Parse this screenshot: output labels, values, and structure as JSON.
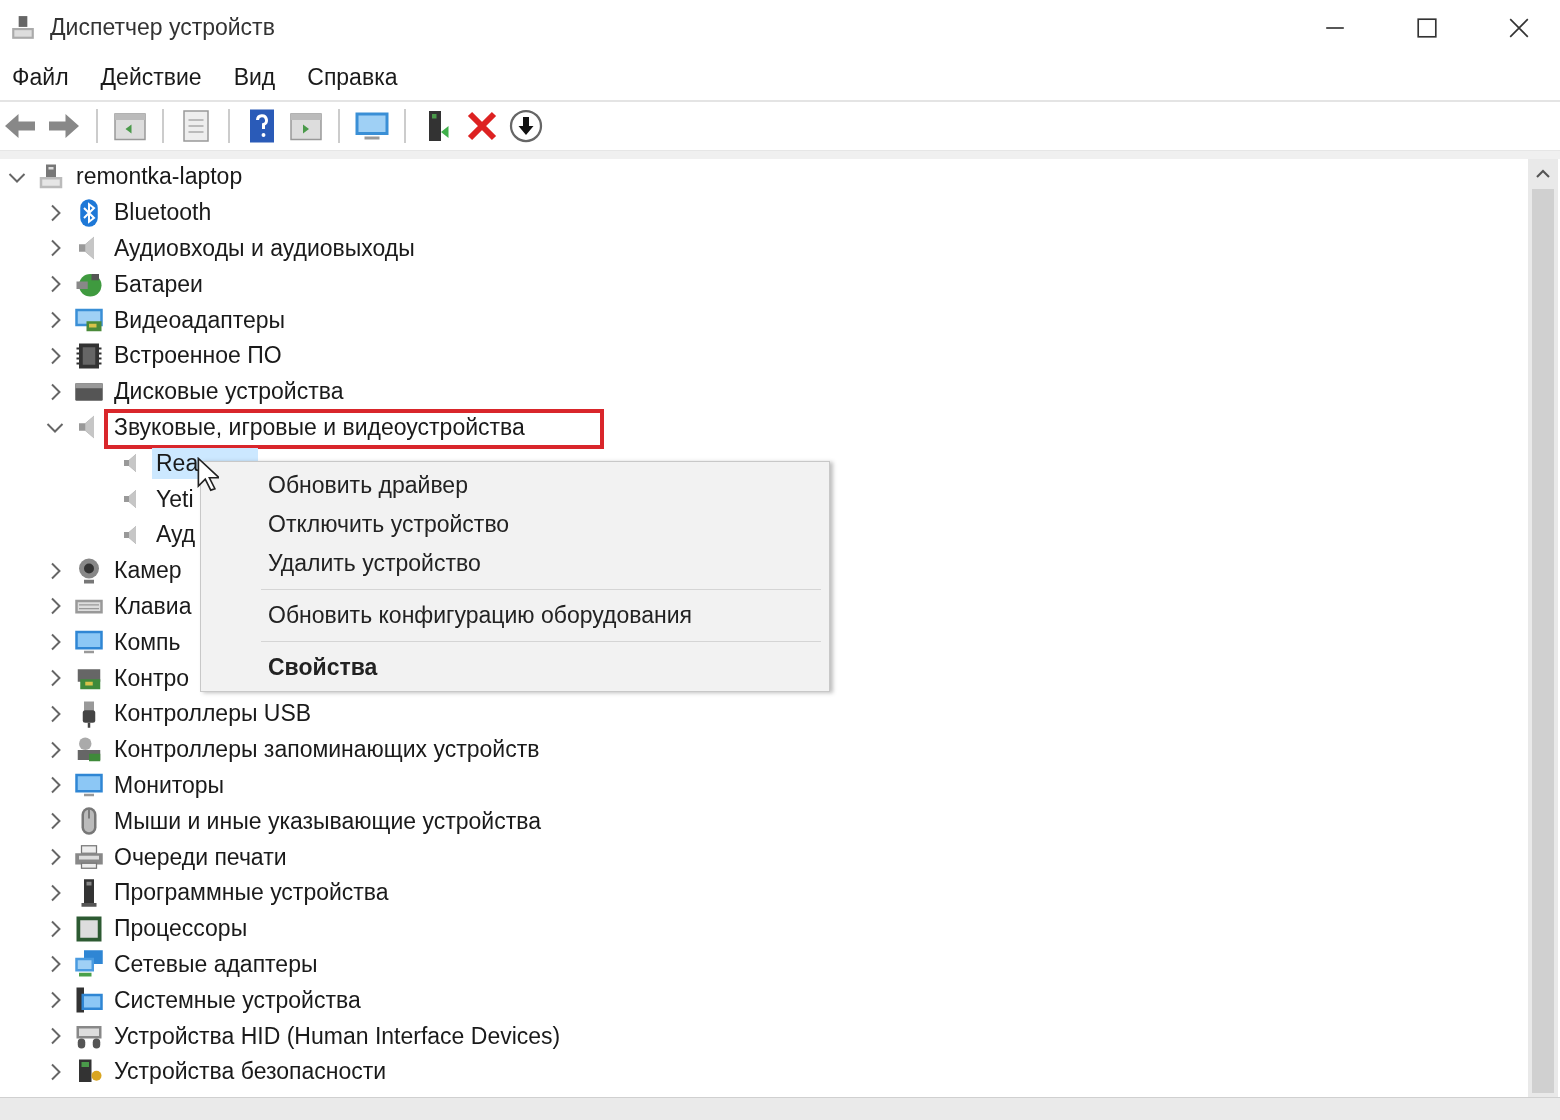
{
  "window": {
    "title": "Диспетчер устройств"
  },
  "menu_bar": [
    "Файл",
    "Действие",
    "Вид",
    "Справка"
  ],
  "tree": {
    "label": "remontka-laptop",
    "expanded": true,
    "selected": false,
    "children": [
      {
        "label": "Bluetooth",
        "expanded": false,
        "selected": false,
        "highlighted": false
      },
      {
        "label": "Аудиовходы и аудиовыходы",
        "expanded": false,
        "selected": false,
        "highlighted": false
      },
      {
        "label": "Батареи",
        "expanded": false,
        "selected": false,
        "highlighted": false
      },
      {
        "label": "Видеоадаптеры",
        "expanded": false,
        "selected": false,
        "highlighted": false
      },
      {
        "label": "Встроенное ПО",
        "expanded": false,
        "selected": false,
        "highlighted": false
      },
      {
        "label": "Дисковые устройства",
        "expanded": false,
        "selected": false,
        "highlighted": false
      },
      {
        "label": "Звуковые, игровые и видеоустройства",
        "expanded": true,
        "selected": false,
        "highlighted": true,
        "children": [
          {
            "label": "Rea",
            "selected": true
          },
          {
            "label": "Yeti",
            "selected": false
          },
          {
            "label": "Ауд",
            "selected": false
          }
        ]
      },
      {
        "label": "Камер",
        "expanded": false,
        "selected": false,
        "highlighted": false
      },
      {
        "label": "Клавиа",
        "expanded": false,
        "selected": false,
        "highlighted": false
      },
      {
        "label": "Компь",
        "expanded": false,
        "selected": false,
        "highlighted": false
      },
      {
        "label": "Контро",
        "expanded": false,
        "selected": false,
        "highlighted": false
      },
      {
        "label": "Контроллеры USB",
        "expanded": false,
        "selected": false,
        "highlighted": false
      },
      {
        "label": "Контроллеры запоминающих устройств",
        "expanded": false,
        "selected": false,
        "highlighted": false
      },
      {
        "label": "Мониторы",
        "expanded": false,
        "selected": false,
        "highlighted": false
      },
      {
        "label": "Мыши и иные указывающие устройства",
        "expanded": false,
        "selected": false,
        "highlighted": false
      },
      {
        "label": "Очереди печати",
        "expanded": false,
        "selected": false,
        "highlighted": false
      },
      {
        "label": "Программные устройства",
        "expanded": false,
        "selected": false,
        "highlighted": false
      },
      {
        "label": "Процессоры",
        "expanded": false,
        "selected": false,
        "highlighted": false
      },
      {
        "label": "Сетевые адаптеры",
        "expanded": false,
        "selected": false,
        "highlighted": false
      },
      {
        "label": "Системные устройства",
        "expanded": false,
        "selected": false,
        "highlighted": false
      },
      {
        "label": "Устройства HID (Human Interface Devices)",
        "expanded": false,
        "selected": false,
        "highlighted": false
      },
      {
        "label": "Устройства безопасности",
        "expanded": false,
        "selected": false,
        "highlighted": false
      }
    ]
  },
  "context_menu": [
    {
      "kind": "item",
      "label": "Обновить драйвер",
      "default": false
    },
    {
      "kind": "item",
      "label": "Отключить устройство",
      "default": false
    },
    {
      "kind": "item",
      "label": "Удалить устройство",
      "default": false
    },
    {
      "kind": "separator"
    },
    {
      "kind": "item",
      "label": "Обновить конфигурацию оборудования",
      "default": false
    },
    {
      "kind": "separator"
    },
    {
      "kind": "item",
      "label": "Свойства",
      "default": true
    }
  ]
}
